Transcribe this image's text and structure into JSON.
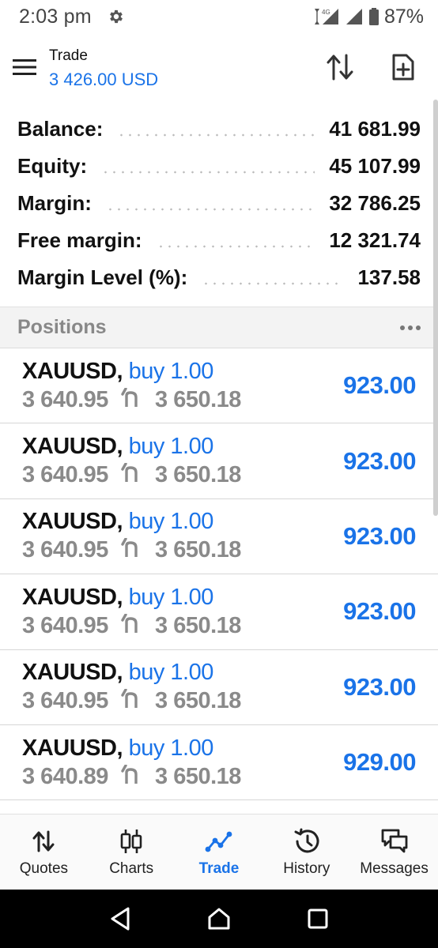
{
  "status_bar": {
    "time": "2:03 pm",
    "network_label": "4G",
    "battery": "87%"
  },
  "header": {
    "title": "Trade",
    "balance": "3 426.00 USD"
  },
  "summary": [
    {
      "label": "Balance:",
      "value": "41 681.99"
    },
    {
      "label": "Equity:",
      "value": "45 107.99"
    },
    {
      "label": "Margin:",
      "value": "32 786.25"
    },
    {
      "label": "Free margin:",
      "value": "12 321.74"
    },
    {
      "label": "Margin Level (%):",
      "value": "137.58"
    }
  ],
  "positions": {
    "title": "Positions",
    "items": [
      {
        "symbol": "XAUUSD,",
        "type": "buy 1.00",
        "open": "3 640.95",
        "current": "3 650.18",
        "profit": "923.00"
      },
      {
        "symbol": "XAUUSD,",
        "type": "buy 1.00",
        "open": "3 640.95",
        "current": "3 650.18",
        "profit": "923.00"
      },
      {
        "symbol": "XAUUSD,",
        "type": "buy 1.00",
        "open": "3 640.95",
        "current": "3 650.18",
        "profit": "923.00"
      },
      {
        "symbol": "XAUUSD,",
        "type": "buy 1.00",
        "open": "3 640.95",
        "current": "3 650.18",
        "profit": "923.00"
      },
      {
        "symbol": "XAUUSD,",
        "type": "buy 1.00",
        "open": "3 640.95",
        "current": "3 650.18",
        "profit": "923.00"
      },
      {
        "symbol": "XAUUSD,",
        "type": "buy 1.00",
        "open": "3 640.89",
        "current": "3 650.18",
        "profit": "929.00"
      }
    ]
  },
  "bottom_nav": {
    "items": [
      {
        "label": "Quotes",
        "icon": "quotes-arrows-icon"
      },
      {
        "label": "Charts",
        "icon": "candlestick-icon"
      },
      {
        "label": "Trade",
        "icon": "trade-line-icon",
        "active": true
      },
      {
        "label": "History",
        "icon": "history-icon"
      },
      {
        "label": "Messages",
        "icon": "messages-icon"
      }
    ]
  },
  "colors": {
    "accent": "#1a73e8",
    "muted": "#8a8a8a",
    "section_bg": "#f3f3f3"
  }
}
